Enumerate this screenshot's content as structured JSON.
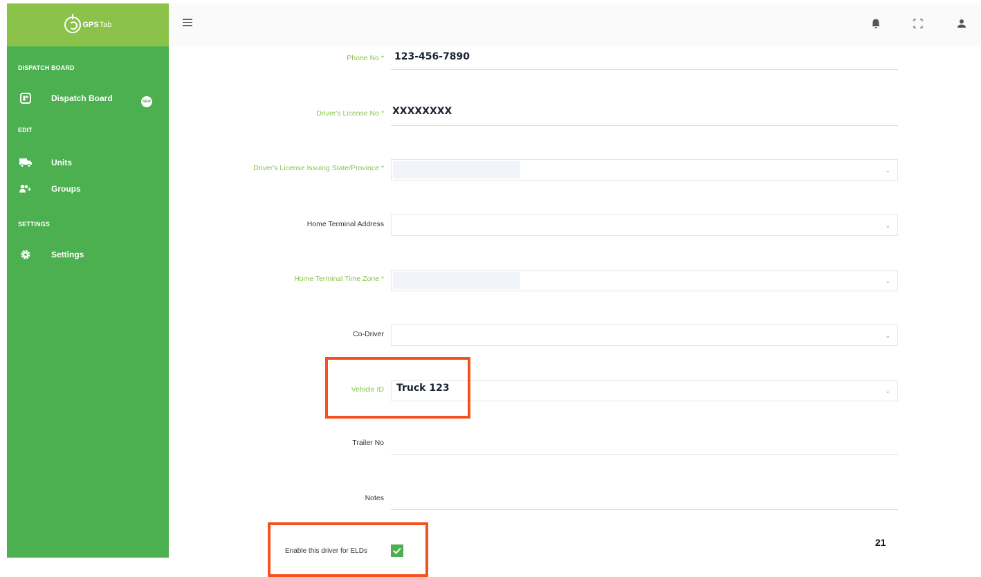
{
  "brand": {
    "name_bold": "GPS",
    "name_light": "Tab"
  },
  "sidebar": {
    "sections": [
      {
        "title": "DISPATCH BOARD"
      },
      {
        "title": "EDIT"
      },
      {
        "title": "SETTINGS"
      }
    ],
    "items": [
      {
        "label": "Dispatch Board",
        "icon": "dashboard-icon",
        "badge": "NEW"
      },
      {
        "label": "Units",
        "icon": "truck-icon"
      },
      {
        "label": "Groups",
        "icon": "group-add-icon"
      },
      {
        "label": "Settings",
        "icon": "gear-icon"
      }
    ]
  },
  "header": {
    "icons": [
      "menu-icon",
      "bell-icon",
      "fullscreen-icon",
      "user-icon"
    ]
  },
  "form": {
    "phone": {
      "label": "Phone No *",
      "value": "123-456-7890"
    },
    "license_no": {
      "label": "Driver's License No *",
      "value": "XXXXXXXX"
    },
    "license_state": {
      "label": "Driver's License Issuing State/Province *",
      "value": ""
    },
    "home_terminal_address": {
      "label": "Home Terminal Address",
      "value": ""
    },
    "home_terminal_tz": {
      "label": "Home Terminal Time Zone *",
      "value": ""
    },
    "co_driver": {
      "label": "Co-Driver",
      "value": ""
    },
    "vehicle_id": {
      "label": "Vehicle ID",
      "value": "Truck 123"
    },
    "trailer_no": {
      "label": "Trailer No",
      "value": ""
    },
    "notes": {
      "label": "Notes",
      "value": ""
    },
    "eld_enable": {
      "label": "Enable this driver for ELDs",
      "checked": true
    }
  },
  "page_number": "21",
  "colors": {
    "sidebar": "#4caf50",
    "brand_bar": "#8bc34a",
    "required_label": "#8bc34a",
    "highlight": "#f4511e"
  }
}
